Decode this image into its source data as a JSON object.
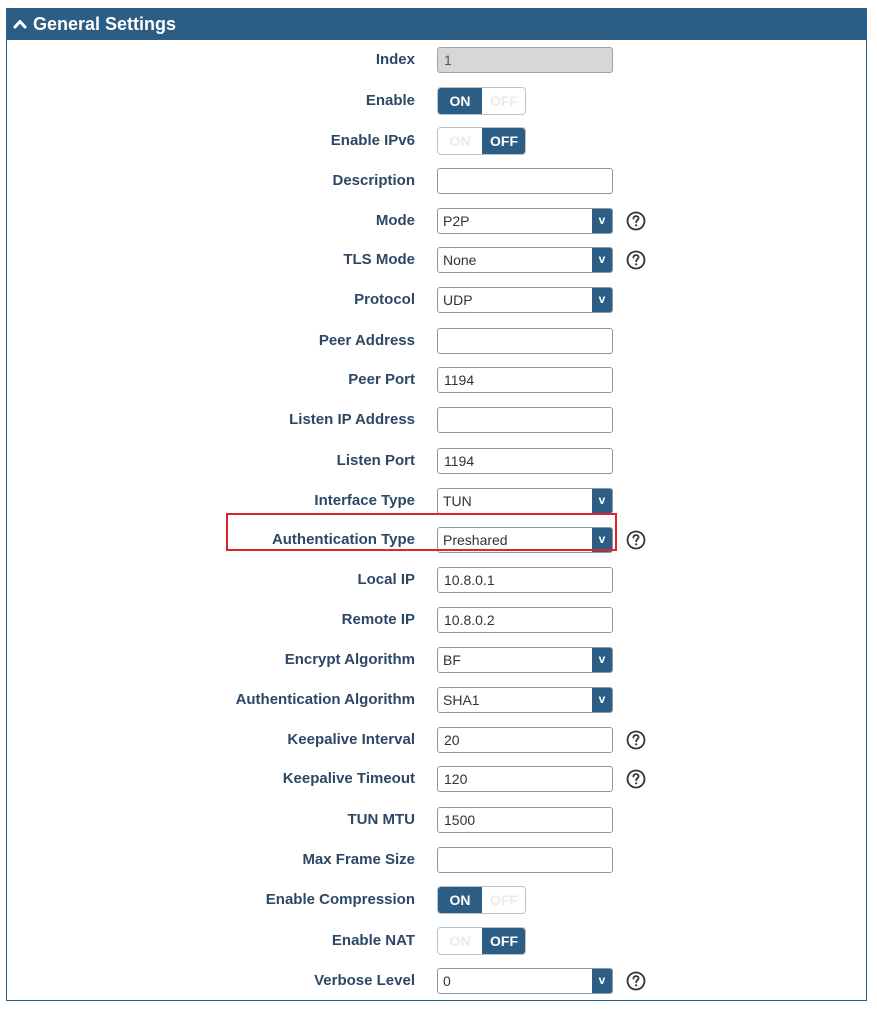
{
  "header": {
    "title": "General Settings"
  },
  "fields": {
    "index": {
      "label": "Index",
      "value": "1"
    },
    "enable": {
      "label": "Enable",
      "on": "ON",
      "off": "OFF",
      "state": "on"
    },
    "enable_ipv6": {
      "label": "Enable IPv6",
      "on": "ON",
      "off": "OFF",
      "state": "off"
    },
    "description": {
      "label": "Description",
      "value": ""
    },
    "mode": {
      "label": "Mode",
      "value": "P2P",
      "arrow": "v"
    },
    "tls_mode": {
      "label": "TLS Mode",
      "value": "None",
      "arrow": "v"
    },
    "protocol": {
      "label": "Protocol",
      "value": "UDP",
      "arrow": "v"
    },
    "peer_address": {
      "label": "Peer Address",
      "value": ""
    },
    "peer_port": {
      "label": "Peer Port",
      "value": "1194"
    },
    "listen_ip": {
      "label": "Listen IP Address",
      "value": ""
    },
    "listen_port": {
      "label": "Listen Port",
      "value": "1194"
    },
    "interface_type": {
      "label": "Interface Type",
      "value": "TUN",
      "arrow": "v"
    },
    "auth_type": {
      "label": "Authentication Type",
      "value": "Preshared",
      "arrow": "v"
    },
    "local_ip": {
      "label": "Local IP",
      "value": "10.8.0.1"
    },
    "remote_ip": {
      "label": "Remote IP",
      "value": "10.8.0.2"
    },
    "encrypt_algorithm": {
      "label": "Encrypt Algorithm",
      "value": "BF",
      "arrow": "v"
    },
    "auth_algorithm": {
      "label": "Authentication Algorithm",
      "value": "SHA1",
      "arrow": "v"
    },
    "keepalive_interval": {
      "label": "Keepalive Interval",
      "value": "20"
    },
    "keepalive_timeout": {
      "label": "Keepalive Timeout",
      "value": "120"
    },
    "tun_mtu": {
      "label": "TUN MTU",
      "value": "1500"
    },
    "max_frame_size": {
      "label": "Max Frame Size",
      "value": ""
    },
    "enable_compression": {
      "label": "Enable Compression",
      "on": "ON",
      "off": "OFF",
      "state": "on"
    },
    "enable_nat": {
      "label": "Enable NAT",
      "on": "ON",
      "off": "OFF",
      "state": "off"
    },
    "verbose_level": {
      "label": "Verbose Level",
      "value": "0",
      "arrow": "v"
    }
  },
  "colors": {
    "header_bg": "#2b5d85",
    "label_text": "#2c4866",
    "highlight_border": "#e0242c"
  },
  "icons": {
    "header_toggle": "chevron-up-icon",
    "help": "question-circle-icon"
  }
}
